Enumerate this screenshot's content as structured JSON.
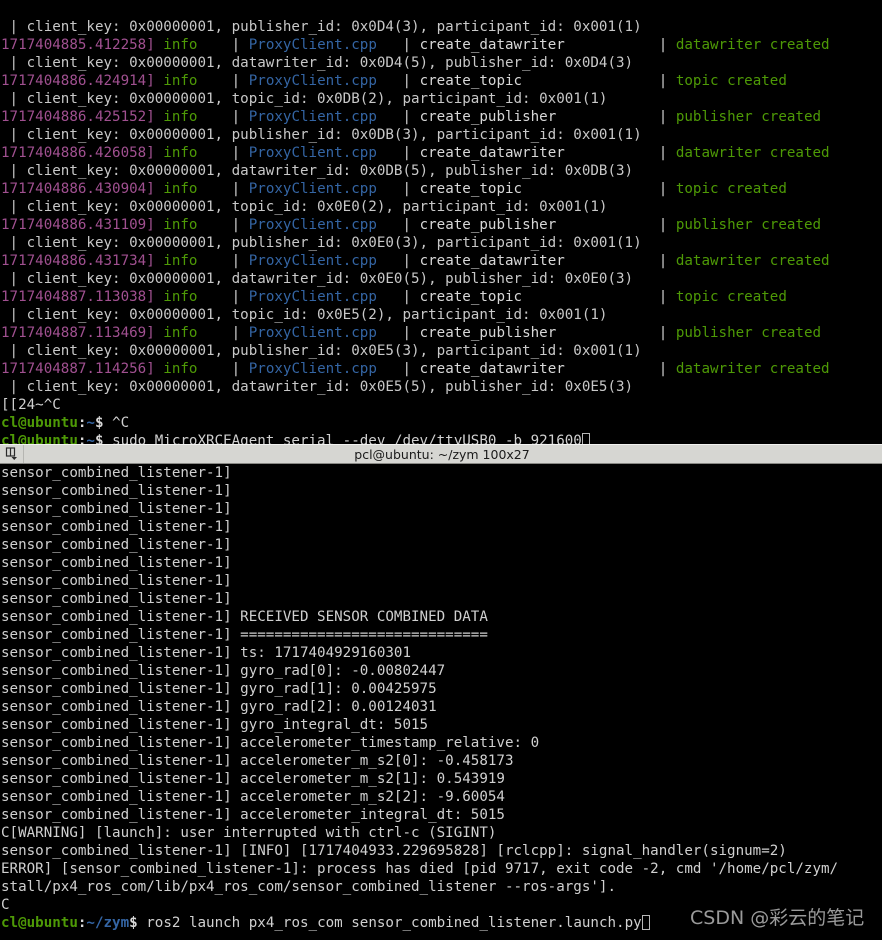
{
  "top_terminal": {
    "name": "micro-xrce-agent-terminal",
    "lines": [
      {
        "type": "log",
        "ts": "",
        "level": "",
        "file": "",
        "func": "",
        "msg": "",
        "clipped_top": true,
        "raw_detail": ""
      },
      {
        "type": "detail",
        "text": " | client_key: 0x00000001, publisher_id: 0x0D4(3), participant_id: 0x001(1)"
      },
      {
        "type": "log",
        "ts": "1717404885.412258]",
        "level": "info",
        "file": "ProxyClient.cpp",
        "func": "create_datawriter",
        "msg": "datawriter created"
      },
      {
        "type": "detail",
        "text": " | client_key: 0x00000001, datawriter_id: 0x0D4(5), publisher_id: 0x0D4(3)"
      },
      {
        "type": "log",
        "ts": "1717404886.424914]",
        "level": "info",
        "file": "ProxyClient.cpp",
        "func": "create_topic",
        "msg": "topic created"
      },
      {
        "type": "detail",
        "text": " | client_key: 0x00000001, topic_id: 0x0DB(2), participant_id: 0x001(1)"
      },
      {
        "type": "log",
        "ts": "1717404886.425152]",
        "level": "info",
        "file": "ProxyClient.cpp",
        "func": "create_publisher",
        "msg": "publisher created"
      },
      {
        "type": "detail",
        "text": " | client_key: 0x00000001, publisher_id: 0x0DB(3), participant_id: 0x001(1)"
      },
      {
        "type": "log",
        "ts": "1717404886.426058]",
        "level": "info",
        "file": "ProxyClient.cpp",
        "func": "create_datawriter",
        "msg": "datawriter created"
      },
      {
        "type": "detail",
        "text": " | client_key: 0x00000001, datawriter_id: 0x0DB(5), publisher_id: 0x0DB(3)"
      },
      {
        "type": "log",
        "ts": "1717404886.430904]",
        "level": "info",
        "file": "ProxyClient.cpp",
        "func": "create_topic",
        "msg": "topic created"
      },
      {
        "type": "detail",
        "text": " | client_key: 0x00000001, topic_id: 0x0E0(2), participant_id: 0x001(1)"
      },
      {
        "type": "log",
        "ts": "1717404886.431109]",
        "level": "info",
        "file": "ProxyClient.cpp",
        "func": "create_publisher",
        "msg": "publisher created"
      },
      {
        "type": "detail",
        "text": " | client_key: 0x00000001, publisher_id: 0x0E0(3), participant_id: 0x001(1)"
      },
      {
        "type": "log",
        "ts": "1717404886.431734]",
        "level": "info",
        "file": "ProxyClient.cpp",
        "func": "create_datawriter",
        "msg": "datawriter created"
      },
      {
        "type": "detail",
        "text": " | client_key: 0x00000001, datawriter_id: 0x0E0(5), publisher_id: 0x0E0(3)"
      },
      {
        "type": "log",
        "ts": "1717404887.113038]",
        "level": "info",
        "file": "ProxyClient.cpp",
        "func": "create_topic",
        "msg": "topic created"
      },
      {
        "type": "detail",
        "text": " | client_key: 0x00000001, topic_id: 0x0E5(2), participant_id: 0x001(1)"
      },
      {
        "type": "log",
        "ts": "1717404887.113469]",
        "level": "info",
        "file": "ProxyClient.cpp",
        "func": "create_publisher",
        "msg": "publisher created"
      },
      {
        "type": "detail",
        "text": " | client_key: 0x00000001, publisher_id: 0x0E5(3), participant_id: 0x001(1)"
      },
      {
        "type": "log",
        "ts": "1717404887.114256]",
        "level": "info",
        "file": "ProxyClient.cpp",
        "func": "create_datawriter",
        "msg": "datawriter created"
      },
      {
        "type": "detail",
        "text": " | client_key: 0x00000001, datawriter_id: 0x0E5(5), publisher_id: 0x0E5(3)"
      },
      {
        "type": "plain",
        "text": "[[24~^C"
      },
      {
        "type": "prompt",
        "user_host": "cl@ubuntu",
        "path": "~",
        "sigil": "$",
        "command": "^C",
        "cursor": false
      },
      {
        "type": "prompt",
        "user_host": "cl@ubuntu",
        "path": "~",
        "sigil": "$",
        "command": "sudo MicroXRCEAgent serial --dev /dev/ttyUSB0 -b 921600",
        "cursor": true
      }
    ]
  },
  "title_bar": {
    "name": "window-title-bar",
    "icon": "window-menu-icon",
    "title": "pcl@ubuntu: ~/zym 100x27"
  },
  "bottom_terminal": {
    "name": "ros2-launch-terminal",
    "node_prefix": "sensor_combined_listener-1]",
    "lines": [
      {
        "type": "plain",
        "text": "sensor_combined_listener-1]"
      },
      {
        "type": "plain",
        "text": "sensor_combined_listener-1]"
      },
      {
        "type": "plain",
        "text": "sensor_combined_listener-1]"
      },
      {
        "type": "plain",
        "text": "sensor_combined_listener-1]"
      },
      {
        "type": "plain",
        "text": "sensor_combined_listener-1]"
      },
      {
        "type": "plain",
        "text": "sensor_combined_listener-1]"
      },
      {
        "type": "plain",
        "text": "sensor_combined_listener-1]"
      },
      {
        "type": "plain",
        "text": "sensor_combined_listener-1]"
      },
      {
        "type": "plain",
        "text": "sensor_combined_listener-1] RECEIVED SENSOR COMBINED DATA"
      },
      {
        "type": "plain",
        "text": "sensor_combined_listener-1] ============================="
      },
      {
        "type": "plain",
        "text": "sensor_combined_listener-1] ts: 1717404929160301"
      },
      {
        "type": "plain",
        "text": "sensor_combined_listener-1] gyro_rad[0]: -0.00802447"
      },
      {
        "type": "plain",
        "text": "sensor_combined_listener-1] gyro_rad[1]: 0.00425975"
      },
      {
        "type": "plain",
        "text": "sensor_combined_listener-1] gyro_rad[2]: 0.00124031"
      },
      {
        "type": "plain",
        "text": "sensor_combined_listener-1] gyro_integral_dt: 5015"
      },
      {
        "type": "plain",
        "text": "sensor_combined_listener-1] accelerometer_timestamp_relative: 0"
      },
      {
        "type": "plain",
        "text": "sensor_combined_listener-1] accelerometer_m_s2[0]: -0.458173"
      },
      {
        "type": "plain",
        "text": "sensor_combined_listener-1] accelerometer_m_s2[1]: 0.543919"
      },
      {
        "type": "plain",
        "text": "sensor_combined_listener-1] accelerometer_m_s2[2]: -9.60054"
      },
      {
        "type": "plain",
        "text": "sensor_combined_listener-1] accelerometer_integral_dt: 5015"
      },
      {
        "type": "plain",
        "text": "C[WARNING] [launch]: user interrupted with ctrl-c (SIGINT)"
      },
      {
        "type": "plain",
        "text": "sensor_combined_listener-1] [INFO] [1717404933.229695828] [rclcpp]: signal_handler(signum=2)"
      },
      {
        "type": "plain",
        "text": "ERROR] [sensor_combined_listener-1]: process has died [pid 9717, exit code -2, cmd '/home/pcl/zym/"
      },
      {
        "type": "plain",
        "text": "stall/px4_ros_com/lib/px4_ros_com/sensor_combined_listener --ros-args']."
      },
      {
        "type": "plain",
        "text": "C"
      },
      {
        "type": "prompt",
        "user_host": "cl@ubuntu",
        "path": "~/zym",
        "sigil": "$",
        "command": "ros2 launch px4_ros_com sensor_combined_listener.launch.py",
        "cursor": true
      }
    ]
  },
  "watermark": {
    "name": "csdn-watermark",
    "text": "CSDN @彩云的笔记"
  },
  "colors": {
    "background": "#000000",
    "foreground": "#d0d0d0",
    "timestamp": "#a05090",
    "info_level": "#4e9a06",
    "filename": "#3465a4",
    "message": "#4e9a06",
    "prompt_user": "#4e9a06",
    "prompt_path": "#3465a4",
    "titlebar_bg": "#d6d6d2",
    "titlebar_fg": "#1a1a1a"
  }
}
